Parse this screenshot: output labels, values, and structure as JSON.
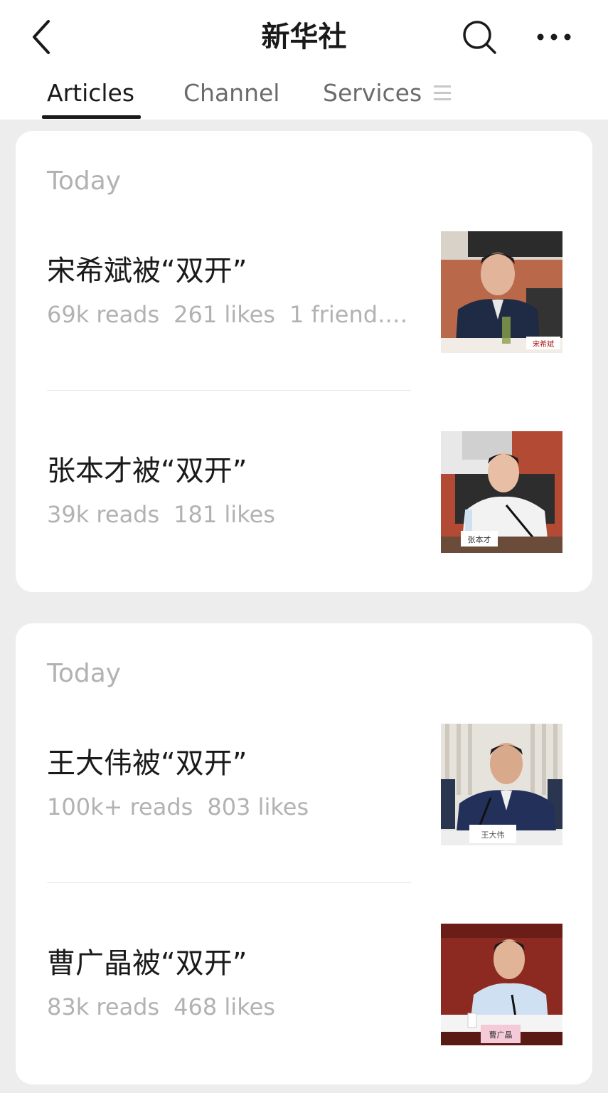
{
  "header": {
    "title": "新华社",
    "back_icon": "chevron-left-icon",
    "search_icon": "search-icon",
    "more_icon": "more-dots-icon"
  },
  "tabs": [
    {
      "label": "Articles",
      "active": true
    },
    {
      "label": "Channel",
      "active": false
    },
    {
      "label": "Services",
      "active": false
    }
  ],
  "services_menu_icon": "menu-lines-icon",
  "groups": [
    {
      "date_label": "Today",
      "articles": [
        {
          "title": "宋希斌被“双开”",
          "reads": "69k reads",
          "likes": "261 likes",
          "friends": "1 friend...",
          "thumb_caption": "宋希斌"
        },
        {
          "title": "张本才被“双开”",
          "reads": "39k reads",
          "likes": "181 likes",
          "thumb_caption": "张本才"
        }
      ]
    },
    {
      "date_label": "Today",
      "articles": [
        {
          "title": "王大伟被“双开”",
          "reads": "100k+ reads",
          "likes": "803 likes",
          "thumb_caption": "王大伟"
        },
        {
          "title": "曹广晶被“双开”",
          "reads": "83k reads",
          "likes": "468 likes",
          "thumb_caption": "曹广晶"
        }
      ]
    }
  ],
  "colors": {
    "background": "#ededed",
    "card": "#ffffff",
    "title_text": "#1a1a1a",
    "meta_text": "#b2b2b2",
    "tab_inactive": "#6b6b6b"
  }
}
